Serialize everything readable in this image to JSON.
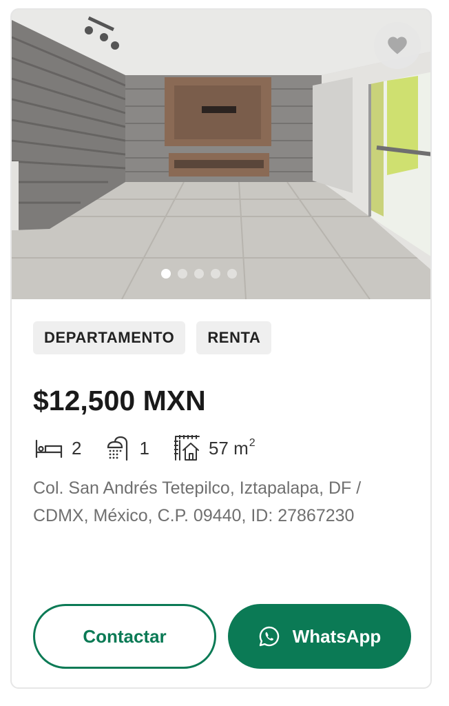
{
  "listing": {
    "tags": [
      "DEPARTAMENTO",
      "RENTA"
    ],
    "price": "$12,500 MXN",
    "bedrooms": "2",
    "bathrooms": "1",
    "area": "57 m",
    "area_sup": "2",
    "address": "Col. San Andrés Tetepilco, Iztapalapa, DF / CDMX, México, C.P. 09440, ID: 27867230"
  },
  "carousel": {
    "slide_count": 5,
    "active_index": 0
  },
  "icons": {
    "favorite": "heart-icon",
    "bed": "bed-icon",
    "shower": "shower-icon",
    "area": "floorplan-icon",
    "whatsapp": "whatsapp-icon"
  },
  "actions": {
    "contact_label": "Contactar",
    "whatsapp_label": "WhatsApp"
  },
  "colors": {
    "accent": "#0b7a55",
    "tag_bg": "#efefef",
    "address_text": "#6f6f6f"
  }
}
